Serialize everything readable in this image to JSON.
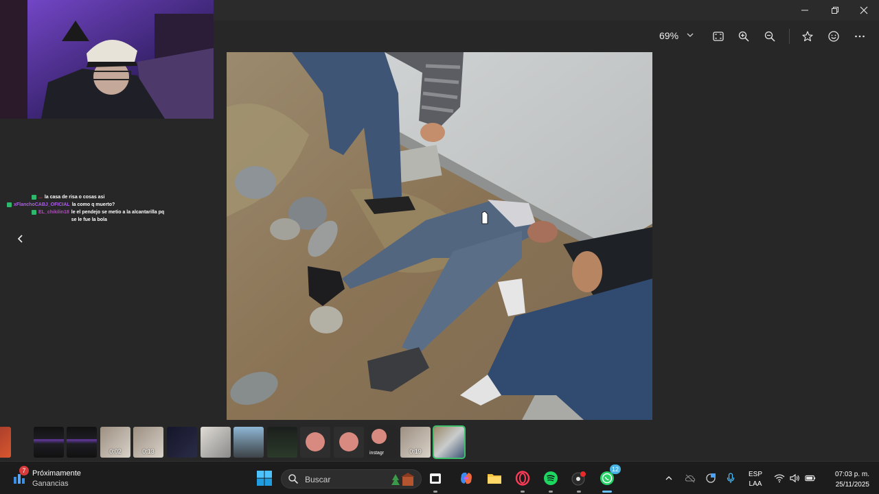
{
  "viewer": {
    "zoom": "69%",
    "window_controls": [
      "minimize",
      "maximize",
      "close"
    ],
    "toolbar_icons": [
      "fit-to-window-icon",
      "zoom-in-icon",
      "zoom-out-icon",
      "favorite-star-icon",
      "smiley-icon",
      "more-icon"
    ]
  },
  "chat": [
    {
      "user": "...",
      "user_color": "#d33a3a",
      "message": "la casa de risa o cosas asi"
    },
    {
      "user": "xFlanchoCABJ_OFICIAL",
      "user_color": "#b05cf0",
      "message": "la como q muerto?"
    },
    {
      "user": "EL_chikilin18",
      "user_color": "#c040d0",
      "message": "le el pendejo se metio a la alcantarilla pq se le fue la bola"
    }
  ],
  "filmstrip": [
    {
      "kind": "red",
      "duration": ""
    },
    {
      "kind": "dark-ui",
      "duration": ""
    },
    {
      "kind": "dark-ui",
      "duration": ""
    },
    {
      "kind": "video",
      "duration": "0:02"
    },
    {
      "kind": "video",
      "duration": "0:13"
    },
    {
      "kind": "dark",
      "duration": ""
    },
    {
      "kind": "shoes",
      "duration": ""
    },
    {
      "kind": "street",
      "duration": ""
    },
    {
      "kind": "chat-screenshot",
      "duration": ""
    },
    {
      "kind": "avatar",
      "duration": ""
    },
    {
      "kind": "avatar",
      "duration": ""
    },
    {
      "kind": "instagram",
      "duration": "",
      "label": "instagr"
    },
    {
      "kind": "video",
      "duration": "0:19"
    },
    {
      "kind": "current",
      "duration": ""
    }
  ],
  "taskbar": {
    "weather_badge": "7",
    "weather_title": "Próximamente",
    "weather_subtitle": "Ganancias",
    "search_placeholder": "Buscar",
    "whatsapp_badge": "12",
    "lang_line1": "ESP",
    "lang_line2": "LAA",
    "time": "07:03 p. m.",
    "date": "25/11/2025"
  },
  "colors": {
    "accent_green": "#3dbf6c",
    "taskbar_bg": "#1c1c1c",
    "viewer_bg": "#272727"
  }
}
